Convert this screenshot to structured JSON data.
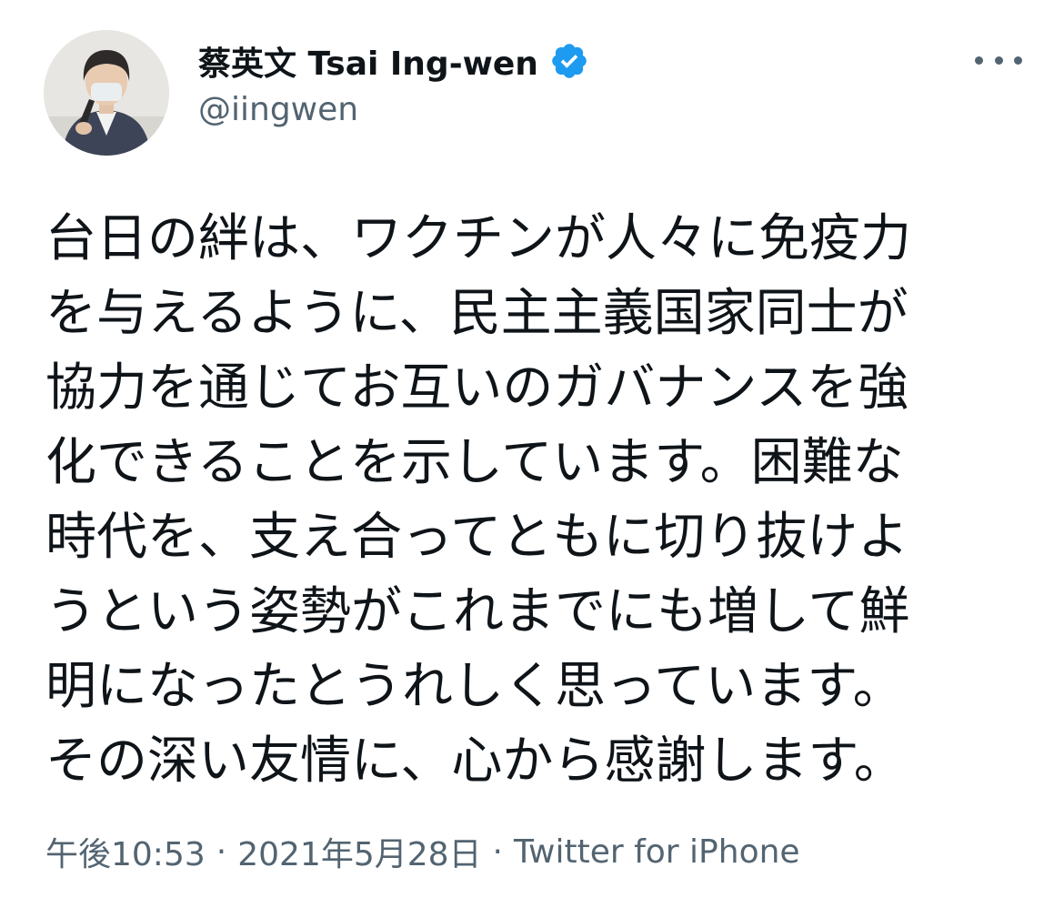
{
  "author": {
    "display_name": "蔡英文 Tsai Ing-wen",
    "handle": "@iingwen",
    "verified": true
  },
  "tweet": {
    "lines": [
      "台日の絆は、ワクチンが人々に免疫力",
      "を与えるように、民主主義国家同士が",
      "協力を通じてお互いのガバナンスを強",
      "化できることを示しています。困難な",
      "時代を、支え合ってともに切り抜けよ",
      "うという姿勢がこれまでにも増して鮮",
      "明になったとうれしく思っています。",
      "その深い友情に、心から感謝します。"
    ]
  },
  "meta": {
    "time": "午後10:53",
    "separator": "·",
    "date": "2021年5月28日",
    "source": "Twitter for iPhone"
  },
  "icons": {
    "verified": "verified-badge-icon",
    "more": "more-horizontal-icon"
  },
  "colors": {
    "text": "#0f1419",
    "secondary": "#536471",
    "verified": "#1d9bf0"
  }
}
